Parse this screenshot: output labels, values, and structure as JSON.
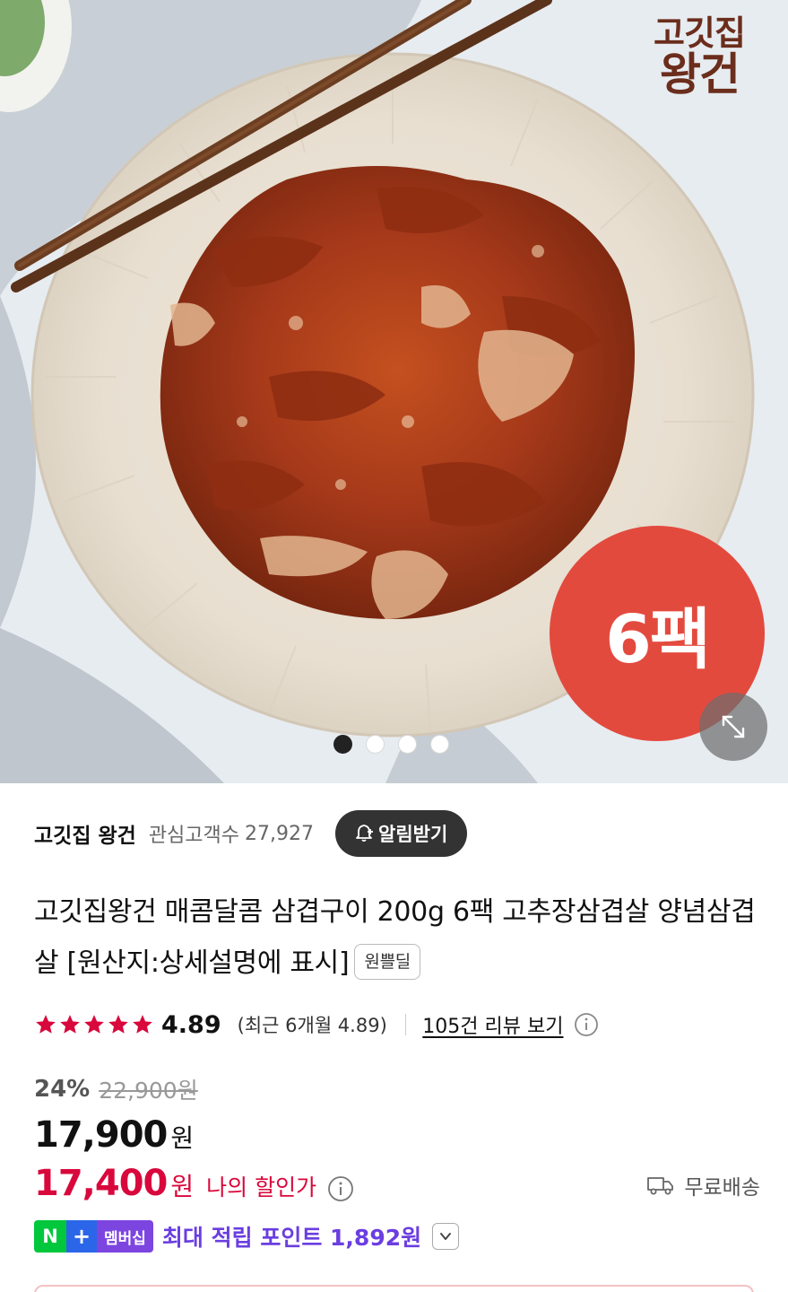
{
  "hero": {
    "brand_logo_line1": "고깃집",
    "brand_logo_line2": "왕건",
    "badge": "6팩",
    "slide_count": 4,
    "active_slide": 1
  },
  "store": {
    "name": "고깃집 왕건",
    "follow_label": "관심고객수",
    "follow_count": "27,927",
    "notify_label": "알림받기"
  },
  "product": {
    "title": "고깃집왕건 매콤달콤 삼겹구이 200g 6팩 고추장삼겹살 양념삼겹살 [원산지:상세설명에 표시]",
    "title_badge": "원쁠딜"
  },
  "rating": {
    "stars": 5,
    "score": "4.89",
    "recent": "(최근 6개월 4.89)",
    "review_link": "105건 리뷰 보기"
  },
  "price": {
    "discount": "24%",
    "original": "22,900원",
    "sale": "17,900",
    "won": "원",
    "my_price": "17,400",
    "my_label": "나의 할인가",
    "shipping": "무료배송"
  },
  "points": {
    "n_label": "N",
    "plus_label": "+",
    "membership_label": "멤버십",
    "text": "최대 적립 포인트 1,892원"
  },
  "colors": {
    "accent_red": "#d9083c",
    "badge_red": "#e34a3e",
    "points_purple": "#6a3ee0",
    "naver_green": "#00c73c"
  }
}
